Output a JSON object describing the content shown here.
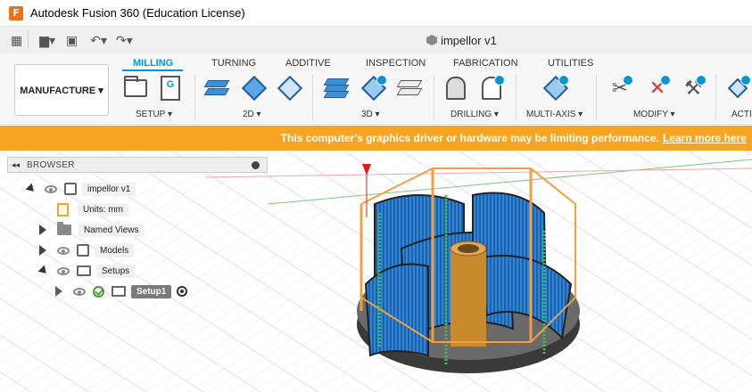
{
  "window": {
    "title": "Autodesk Fusion 360 (Education License)",
    "logo_letter": "F"
  },
  "document": {
    "name": "impellor v1"
  },
  "quick_access": {
    "grid_icon": "grid-icon",
    "file_icon": "file-icon",
    "save_icon": "save-icon",
    "undo_icon": "undo-icon",
    "redo_icon": "redo-icon"
  },
  "ribbon": {
    "workspace": "MANUFACTURE ▾",
    "tabs": [
      "MILLING",
      "TURNING",
      "ADDITIVE",
      "INSPECTION",
      "FABRICATION",
      "UTILITIES"
    ],
    "active_tab": "MILLING",
    "groups": [
      "SETUP ▾",
      "2D ▾",
      "3D ▾",
      "DRILLING ▾",
      "MULTI-AXIS ▾",
      "MODIFY ▾",
      "ACTI"
    ],
    "setup_sheet_letter": "G"
  },
  "banner": {
    "message": "This computer's graphics driver or hardware may be limiting performance.",
    "link": "Learn more here"
  },
  "browser": {
    "title": "BROWSER",
    "collapse_glyph": "◂◂",
    "items": [
      {
        "label": "impellor v1"
      },
      {
        "label": "Units: mm"
      },
      {
        "label": "Named Views"
      },
      {
        "label": "Models"
      },
      {
        "label": "Setups"
      },
      {
        "label": "Setup1"
      }
    ]
  },
  "colors": {
    "accent": "#0696d7",
    "banner": "#f5a523",
    "toolpath_blue": "#2f86d8",
    "stock_orange": "#f0a040",
    "origin_red": "#e01b1b"
  }
}
